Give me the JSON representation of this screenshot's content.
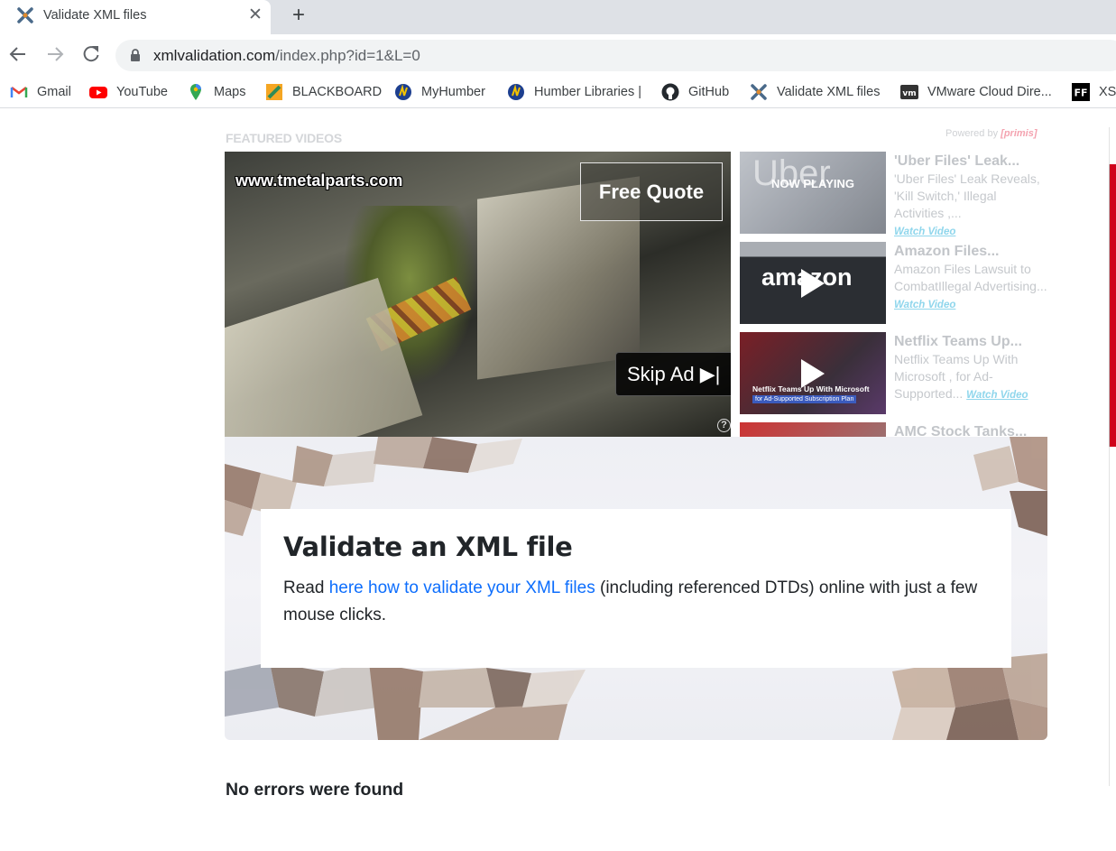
{
  "tab": {
    "title": "Validate XML files",
    "close": "✕",
    "new_tab": "+"
  },
  "toolbar": {
    "url_host": "xmlvalidation.com",
    "url_path": "/index.php?id=1&L=0"
  },
  "bookmarks": [
    {
      "label": "Gmail",
      "icon": "gmail-icon"
    },
    {
      "label": "YouTube",
      "icon": "youtube-icon"
    },
    {
      "label": "Maps",
      "icon": "maps-icon"
    },
    {
      "label": "BLACKBOARD",
      "icon": "blackboard-icon"
    },
    {
      "label": "MyHumber",
      "icon": "humber-icon"
    },
    {
      "label": "Humber Libraries |",
      "icon": "humber-icon"
    },
    {
      "label": "GitHub",
      "icon": "github-icon"
    },
    {
      "label": "Validate XML files",
      "icon": "xmlvalidation-icon"
    },
    {
      "label": "VMware Cloud Dire...",
      "icon": "vmware-icon"
    },
    {
      "label": "XSD",
      "icon": "ff-icon"
    }
  ],
  "ad": {
    "featured_label": "FEATURED VIDEOS",
    "powered_by": "Powered by",
    "powered_brand": "[primis]",
    "video": {
      "watermark": "www.tmetalparts.com",
      "quote_button": "Free Quote",
      "skip_button": "Skip Ad ▶|",
      "help": "?"
    },
    "playlist": [
      {
        "title": "'Uber Files' Leak...",
        "description": "'Uber Files' Leak Reveals, 'Kill Switch,' Illegal Activities ,...",
        "watch": "Watch Video",
        "overlay": "NOW PLAYING",
        "thumb_text": "Uber"
      },
      {
        "title": "Amazon Files...",
        "description": "Amazon Files Lawsuit to CombatIllegal Advertising...",
        "watch": "Watch Video",
        "thumb_text": "amazon"
      },
      {
        "title": "Netflix Teams Up...",
        "description": "Netflix Teams Up With Microsoft , for Ad-Supported...",
        "watch": "Watch Video",
        "thumb_text": "Netflix Teams Up With Microsoft",
        "thumb_subtext": "for Ad-Supported Subscription Plan"
      },
      {
        "title": "AMC Stock Tanks..."
      }
    ]
  },
  "main": {
    "heading": "Validate an XML file",
    "intro_before": "Read ",
    "intro_link": "here how to validate your XML files",
    "intro_after": " (including referenced DTDs) online with just a few mouse clicks.",
    "result": "No errors were found"
  },
  "colors": {
    "link": "#0d6efd",
    "chrome_bg": "#dee1e6",
    "omnibox": "#f1f3f4"
  }
}
